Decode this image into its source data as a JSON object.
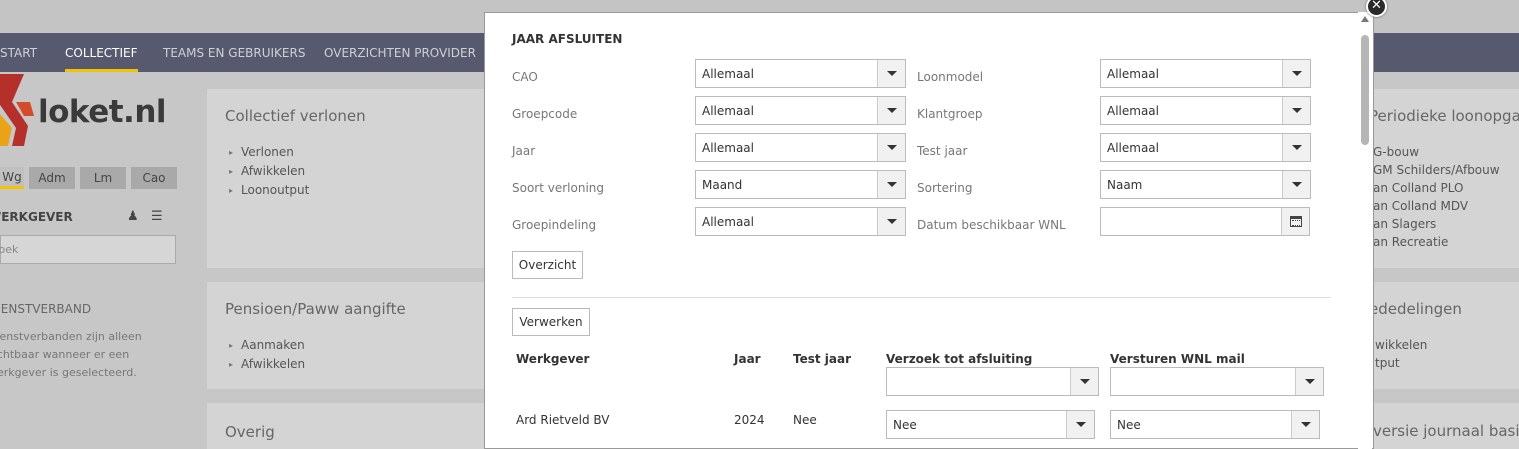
{
  "nav": {
    "items": [
      "START",
      "COLLECTIEF",
      "TEAMS EN GEBRUIKERS",
      "OVERZICHTEN PROVIDER"
    ],
    "active": "COLLECTIEF"
  },
  "logo": {
    "text": "loket.nl"
  },
  "sidebar": {
    "segments": [
      "Wg",
      "Adm",
      "Lm",
      "Cao"
    ],
    "werkgever_title": "WERKGEVER",
    "search_placeholder": "Zoek",
    "dienstverband_title": "DIENSTVERBAND",
    "dienstverband_text": [
      "Dienstverbanden zijn alleen",
      "zichtbaar wanneer er een",
      "werkgever is geselecteerd."
    ]
  },
  "panels": {
    "collectief_verlonen": {
      "title": "Collectief verlonen",
      "items": [
        "Verlonen",
        "Afwikkelen",
        "Loonoutput"
      ]
    },
    "pensioen": {
      "title": "Pensioen/Paww aangifte",
      "items": [
        "Aanmaken",
        "Afwikkelen"
      ]
    },
    "overig": {
      "title": "Overig"
    },
    "periodieke": {
      "title": "Periodieke loonopgave M",
      "items": [
        "G-bouw",
        "GM Schilders/Afbouw",
        "an Colland PLO",
        "an Colland MDV",
        "an Slagers",
        "an Recreatie"
      ]
    },
    "mededelingen": {
      "title": "ededelingen",
      "items": [
        "wikkelen",
        "tput"
      ]
    },
    "journaal": {
      "title": "versie journaal basis"
    }
  },
  "modal": {
    "title": "JAAR AFSLUITEN",
    "fields": {
      "cao": {
        "label": "CAO",
        "value": "Allemaal"
      },
      "loonmodel": {
        "label": "Loonmodel",
        "value": "Allemaal"
      },
      "groepcode": {
        "label": "Groepcode",
        "value": "Allemaal"
      },
      "klantgroep": {
        "label": "Klantgroep",
        "value": "Allemaal"
      },
      "jaar": {
        "label": "Jaar",
        "value": "Allemaal"
      },
      "test_jaar": {
        "label": "Test jaar",
        "value": "Allemaal"
      },
      "soort_verloning": {
        "label": "Soort verloning",
        "value": "Maand"
      },
      "sortering": {
        "label": "Sortering",
        "value": "Naam"
      },
      "groepindeling": {
        "label": "Groepindeling",
        "value": "Allemaal"
      },
      "datum_wnl": {
        "label": "Datum beschikbaar WNL",
        "value": ""
      }
    },
    "overzicht_label": "Overzicht",
    "verwerken_label": "Verwerken",
    "table": {
      "headers": {
        "werkgever": "Werkgever",
        "jaar": "Jaar",
        "test_jaar": "Test jaar",
        "verzoek": "Verzoek tot afsluiting",
        "wnl_mail": "Versturen WNL mail"
      },
      "filters": {
        "verzoek": "",
        "wnl_mail": ""
      },
      "rows": [
        {
          "werkgever": "Ard Rietveld BV",
          "jaar": "2024",
          "test_jaar": "Nee",
          "verzoek": "Nee",
          "wnl_mail": "Nee"
        }
      ]
    }
  }
}
